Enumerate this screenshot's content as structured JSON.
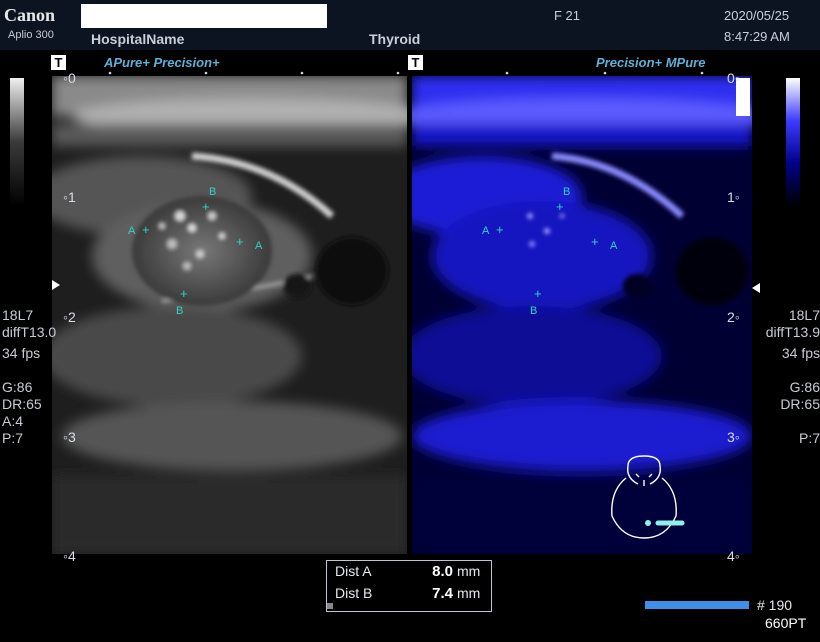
{
  "header": {
    "logo": "Canon",
    "model": "Aplio 300",
    "hospital": "HospitalName",
    "organ": "Thyroid",
    "frame_rate_label": "F 21",
    "date": "2020/05/25",
    "time": "8:47:29 AM"
  },
  "left_image": {
    "mode_t": "T",
    "mode_label": "APure+ Precision+",
    "depth_labels": [
      "0",
      "1",
      "2",
      "3",
      "4"
    ]
  },
  "right_image": {
    "mode_t": "T",
    "mode_label": "Precision+ MPure",
    "depth_labels": [
      "0",
      "1",
      "2",
      "3",
      "4"
    ]
  },
  "left_params": [
    "18L7",
    "diffT13.0",
    "34 fps",
    "",
    "G:86",
    "DR:65",
    "A:4",
    "P:7"
  ],
  "right_params": [
    "18L7",
    "diffT13.9",
    "34 fps",
    "",
    "G:86",
    "DR:65",
    "",
    "P:7"
  ],
  "calipers": {
    "a": "A",
    "b": "B"
  },
  "measurements": [
    {
      "label": "Dist A",
      "value": "8.0",
      "unit": "mm"
    },
    {
      "label": "Dist B",
      "value": "7.4",
      "unit": "mm"
    }
  ],
  "footer": {
    "frame_number": "# 190",
    "probe_preset": "660PT",
    "cine_progress": 1.0
  },
  "colors": {
    "caliper": "#2fd5c6",
    "header_bg": "#0b1420",
    "blue_map": "#1414ff"
  },
  "icons": [
    "t-mode-icon",
    "gray-map-bar",
    "color-map-bar",
    "body-marker-head-icon",
    "probe-marker-icon",
    "focus-marker-icon"
  ]
}
